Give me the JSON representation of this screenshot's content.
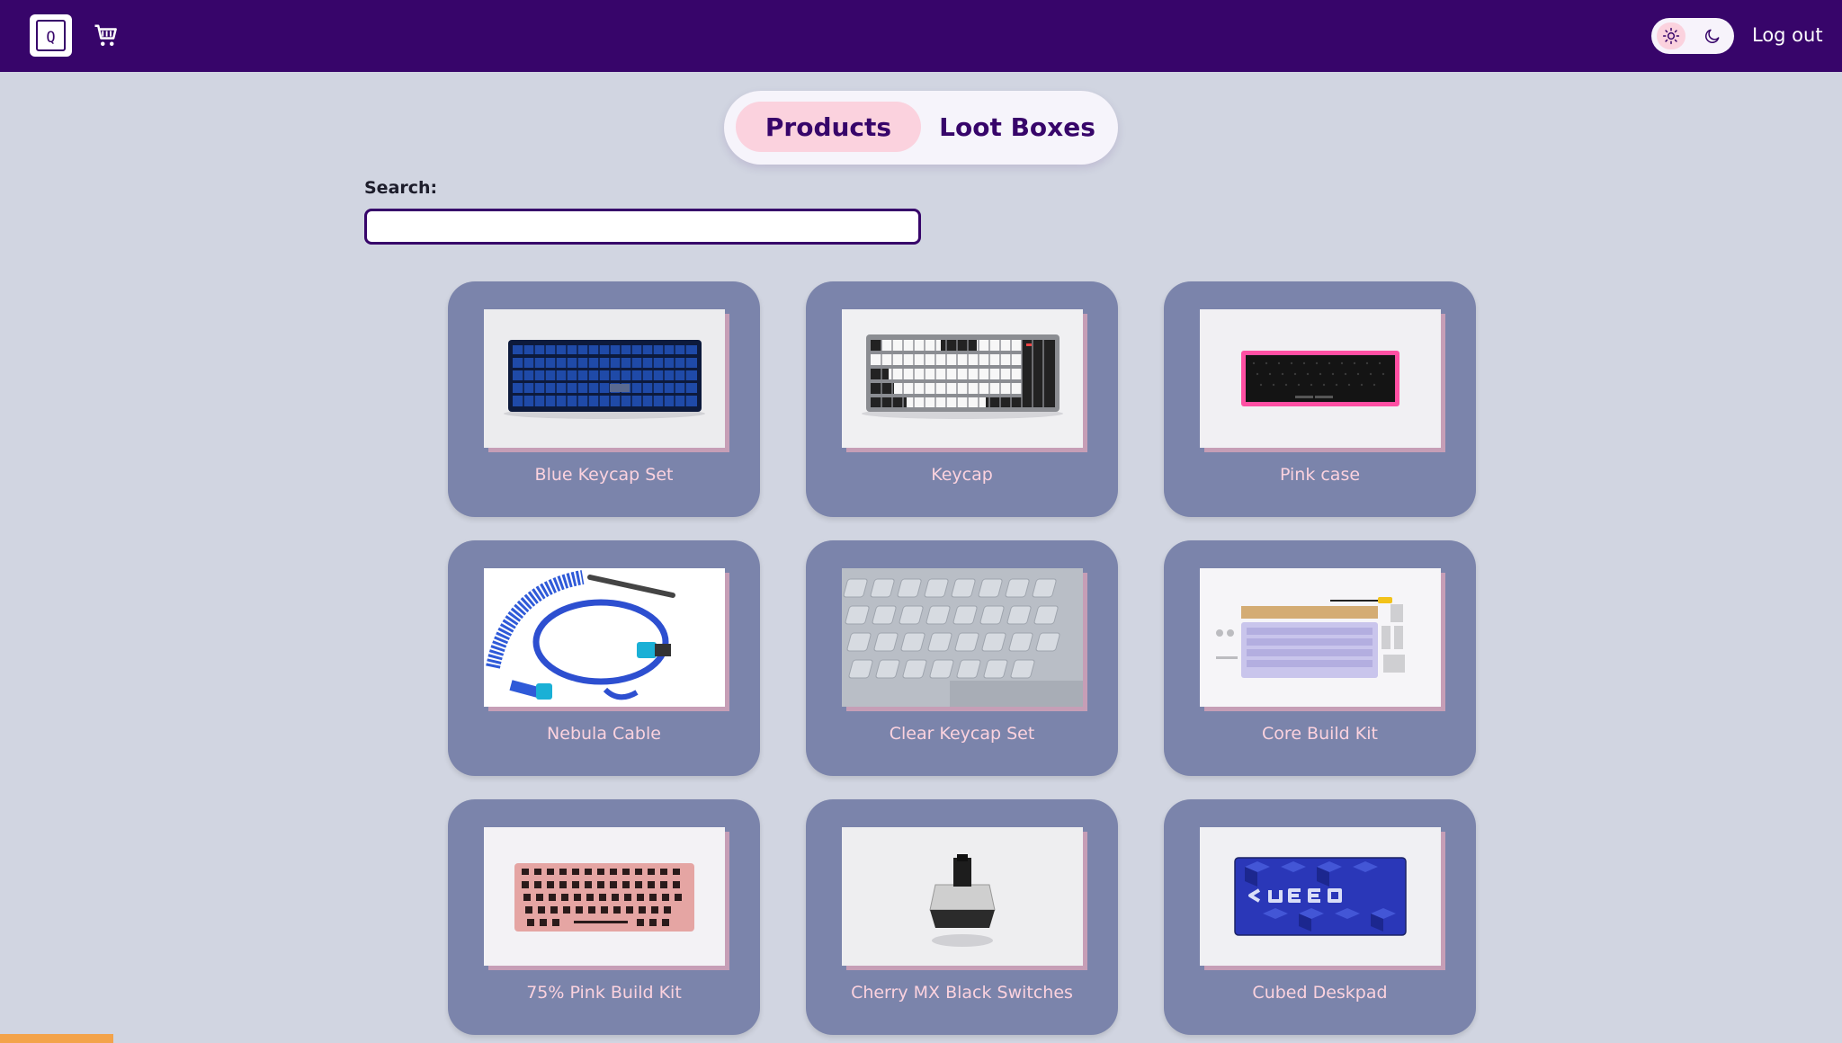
{
  "header": {
    "logo_letter": "Q",
    "logo_icon": "logo-q-icon",
    "cart_icon": "cart-icon",
    "theme": {
      "light_icon": "sun-icon",
      "dark_icon": "moon-icon",
      "selected": "light"
    },
    "logout_label": "Log out"
  },
  "tabs": {
    "products_label": "Products",
    "loot_label": "Loot Boxes",
    "active": "products"
  },
  "search": {
    "label": "Search:",
    "value": "",
    "placeholder": ""
  },
  "products": [
    {
      "title": "Blue Keycap Set"
    },
    {
      "title": "Keycap"
    },
    {
      "title": "Pink case"
    },
    {
      "title": "Nebula Cable"
    },
    {
      "title": "Clear Keycap Set"
    },
    {
      "title": "Core Build Kit"
    },
    {
      "title": "75% Pink Build Kit"
    },
    {
      "title": "Cherry MX Black Switches"
    },
    {
      "title": "Cubed Deskpad"
    }
  ],
  "colors": {
    "header_bg": "#37056a",
    "page_bg": "#d1d5e1",
    "card_bg": "#7b84ab",
    "card_title": "#fbd2de",
    "active_tab_bg": "#fbd2de"
  }
}
